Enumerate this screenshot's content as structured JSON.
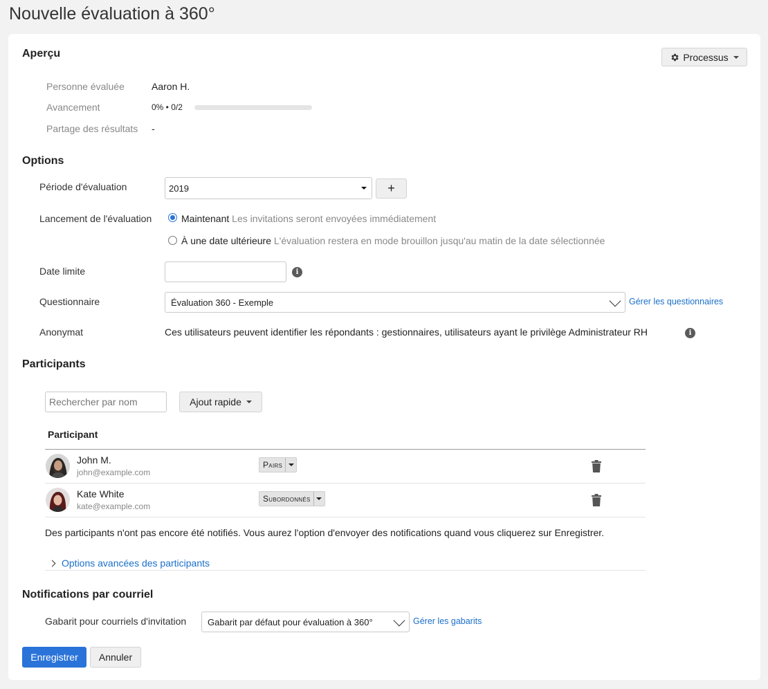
{
  "page_title": "Nouvelle évaluation à 360°",
  "overview": {
    "title": "Aperçu",
    "process_button": "Processus",
    "evaluated_label": "Personne évaluée",
    "evaluated_value": "Aaron H.",
    "progress_label": "Avancement",
    "progress_text": "0% • 0/2",
    "progress_percent": 0,
    "sharing_label": "Partage des résultats",
    "sharing_value": "-"
  },
  "options": {
    "title": "Options",
    "period_label": "Période d'évaluation",
    "period_value": "2019",
    "add_period_button": "+",
    "launch_label": "Lancement de l'évaluation",
    "launch_now_label": "Maintenant",
    "launch_now_desc": "Les invitations seront envoyées immédiatement",
    "launch_later_label": "À une date ultérieure",
    "launch_later_desc": "L'évaluation restera en mode brouillon jusqu'au matin de la date sélectionnée",
    "launch_selected": "now",
    "deadline_label": "Date limite",
    "deadline_value": "",
    "questionnaire_label": "Questionnaire",
    "questionnaire_value": "Évaluation 360 - Exemple",
    "manage_questionnaires_link": "Gérer les questionnaires",
    "anonymity_label": "Anonymat",
    "anonymity_text": "Ces utilisateurs peuvent identifier les répondants : gestionnaires, utilisateurs ayant le privilège Administrateur RH"
  },
  "participants": {
    "title": "Participants",
    "search_placeholder": "Rechercher par nom",
    "quick_add_button": "Ajout rapide",
    "column_header": "Participant",
    "rows": [
      {
        "name": "John M.",
        "email": "john@example.com",
        "role": "Pairs"
      },
      {
        "name": "Kate White",
        "email": "kate@example.com",
        "role": "Subordonnés"
      }
    ],
    "notice": "Des participants n'ont pas encore été notifiés. Vous aurez l'option d'envoyer des notifications quand vous cliquerez sur Enregistrer.",
    "advanced_options_link": "Options avancées des participants"
  },
  "notifications": {
    "title": "Notifications par courriel",
    "template_label": "Gabarit pour courriels d'invitation",
    "template_value": "Gabarit par défaut pour évaluation à 360°",
    "manage_templates_link": "Gérer les gabarits"
  },
  "footer": {
    "save_button": "Enregistrer",
    "cancel_button": "Annuler"
  },
  "colors": {
    "primary": "#2a73d9",
    "link": "#1a6fc9",
    "background": "#f2f2f2"
  }
}
